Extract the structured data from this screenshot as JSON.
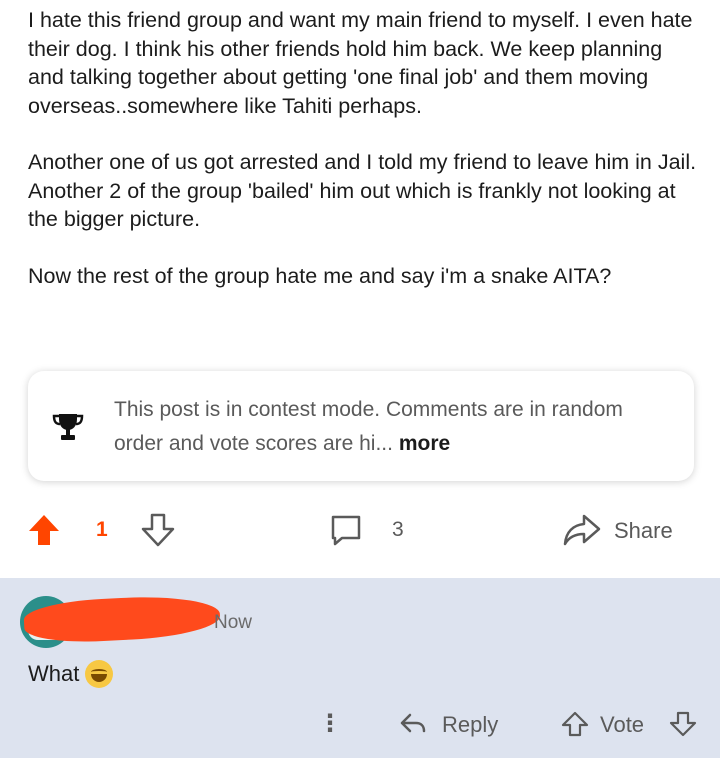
{
  "post": {
    "paragraphs": [
      "I hate this friend group and want my main friend to myself. I even hate their dog. I think his other friends hold him back. We keep planning and talking together about getting 'one final job' and them moving overseas..somewhere like Tahiti perhaps.",
      "Another one of us got arrested and I told my friend to leave him in Jail. Another 2 of the group 'bailed' him out which is frankly not looking at the bigger picture.",
      "Now the rest of the group hate me and say i'm a snake AITA?"
    ]
  },
  "contest_notice": {
    "text": "This post is in contest mode. Comments are in random order and vote scores are hi...",
    "more_label": "more",
    "icon": "trophy-icon"
  },
  "post_actions": {
    "vote_count": "1",
    "comment_count": "3",
    "share_label": "Share",
    "accent_color": "#ff4500"
  },
  "comment": {
    "time": "Now",
    "text": "What",
    "emoji": "grinning-sweat-emoji",
    "reply_label": "Reply",
    "vote_label": "Vote",
    "background_color": "#dde3ef"
  }
}
